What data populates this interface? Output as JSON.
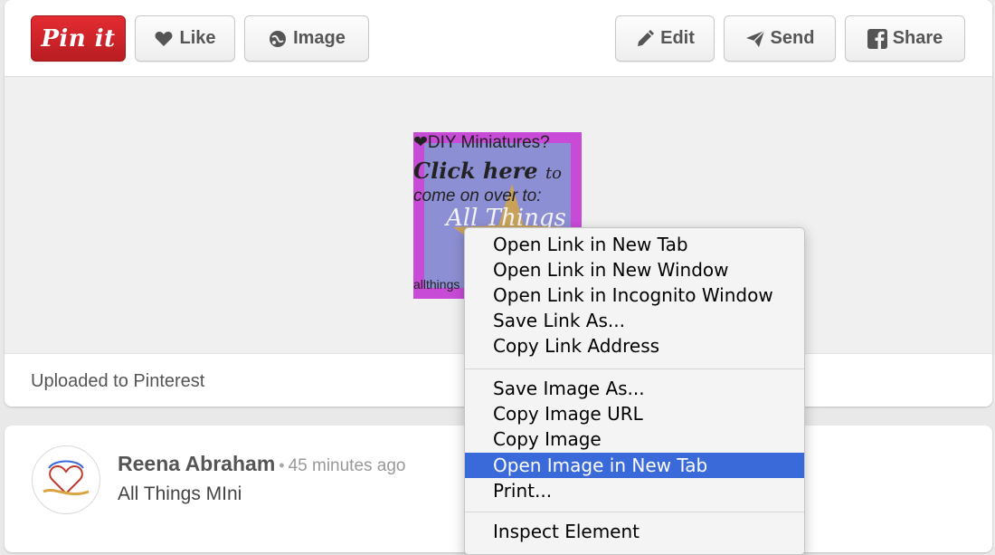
{
  "toolbar": {
    "pinit_label": "Pin it",
    "like_label": "Like",
    "image_label": "Image",
    "edit_label": "Edit",
    "send_label": "Send",
    "share_label": "Share"
  },
  "pin": {
    "caption": "Uploaded to Pinterest",
    "image_text": {
      "line1": "❤DIY Miniatures?",
      "line2": "Click here",
      "line2b": "to",
      "line3": "come on over to:",
      "line4": "All Things",
      "line5": "allthings"
    }
  },
  "comment": {
    "user_name": "Reena Abraham",
    "separator": "•",
    "time": "45 minutes ago",
    "board": "All Things MIni"
  },
  "context_menu": {
    "items": [
      "Open Link in New Tab",
      "Open Link in New Window",
      "Open Link in Incognito Window",
      "Save Link As...",
      "Copy Link Address",
      "Save Image As...",
      "Copy Image URL",
      "Copy Image",
      "Open Image in New Tab",
      "Print...",
      "Inspect Element"
    ],
    "highlighted": "Open Image in New Tab"
  },
  "colors": {
    "pinit_red": "#cb2027",
    "menu_highlight": "#3a6ad9",
    "thumb_magenta": "#c84bd8"
  },
  "icons": [
    "heart-icon",
    "image-icon",
    "pencil-icon",
    "paper-plane-icon",
    "facebook-icon"
  ]
}
